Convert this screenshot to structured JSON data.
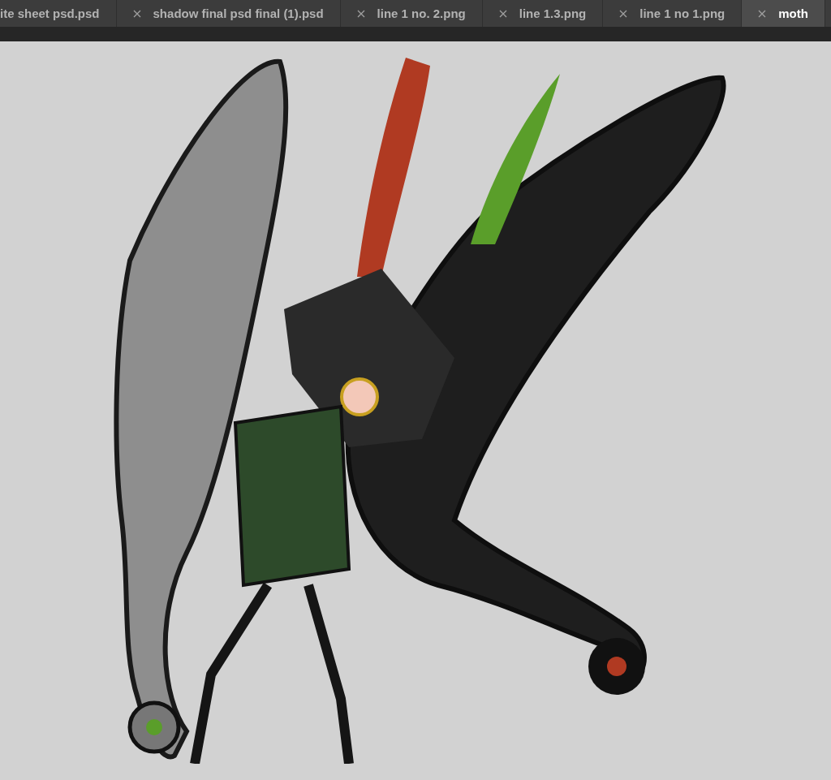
{
  "tabs": [
    {
      "label": "ite sheet psd.psd",
      "selected": false,
      "closable": false
    },
    {
      "label": "shadow final psd final (1).psd",
      "selected": false,
      "closable": true
    },
    {
      "label": "line 1 no. 2.png",
      "selected": false,
      "closable": true
    },
    {
      "label": "line 1.3.png",
      "selected": false,
      "closable": true
    },
    {
      "label": "line 1 no 1.png",
      "selected": false,
      "closable": true
    },
    {
      "label": "moth",
      "selected": true,
      "closable": true
    }
  ]
}
